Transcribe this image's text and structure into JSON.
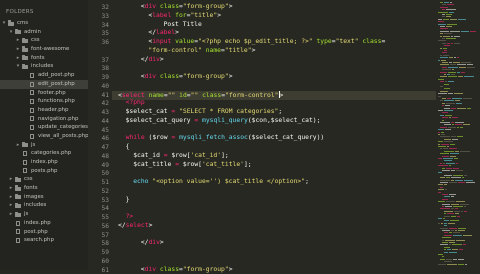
{
  "sidebar": {
    "header": "FOLDERS",
    "items": [
      {
        "type": "folder",
        "depth": 0,
        "label": "cms",
        "open": true,
        "selected": false
      },
      {
        "type": "folder",
        "depth": 1,
        "label": "admin",
        "open": true,
        "selected": false
      },
      {
        "type": "folder",
        "depth": 2,
        "label": "css",
        "open": false,
        "selected": false
      },
      {
        "type": "folder",
        "depth": 2,
        "label": "font-awesome",
        "open": false,
        "selected": false
      },
      {
        "type": "folder",
        "depth": 2,
        "label": "fonts",
        "open": false,
        "selected": false
      },
      {
        "type": "folder",
        "depth": 2,
        "label": "includes",
        "open": true,
        "selected": false
      },
      {
        "type": "file",
        "depth": 3,
        "label": "add_post.php",
        "selected": false
      },
      {
        "type": "file",
        "depth": 3,
        "label": "edit_post.php",
        "selected": true
      },
      {
        "type": "file",
        "depth": 3,
        "label": "footer.php",
        "selected": false
      },
      {
        "type": "file",
        "depth": 3,
        "label": "functions.php",
        "selected": false
      },
      {
        "type": "file",
        "depth": 3,
        "label": "header.php",
        "selected": false
      },
      {
        "type": "file",
        "depth": 3,
        "label": "navigation.php",
        "selected": false
      },
      {
        "type": "file",
        "depth": 3,
        "label": "update_categories.p",
        "selected": false
      },
      {
        "type": "file",
        "depth": 3,
        "label": "view_all_posts.php",
        "selected": false
      },
      {
        "type": "folder",
        "depth": 2,
        "label": "js",
        "open": false,
        "selected": false
      },
      {
        "type": "file",
        "depth": 2,
        "label": "categories.php",
        "selected": false
      },
      {
        "type": "file",
        "depth": 2,
        "label": "index.php",
        "selected": false
      },
      {
        "type": "file",
        "depth": 2,
        "label": "posts.php",
        "selected": false
      },
      {
        "type": "folder",
        "depth": 1,
        "label": "css",
        "open": false,
        "selected": false
      },
      {
        "type": "folder",
        "depth": 1,
        "label": "fonts",
        "open": false,
        "selected": false
      },
      {
        "type": "folder",
        "depth": 1,
        "label": "images",
        "open": false,
        "selected": false
      },
      {
        "type": "folder",
        "depth": 1,
        "label": "includes",
        "open": false,
        "selected": false
      },
      {
        "type": "folder",
        "depth": 1,
        "label": "js",
        "open": false,
        "selected": false
      },
      {
        "type": "file",
        "depth": 1,
        "label": "index.php",
        "selected": false
      },
      {
        "type": "file",
        "depth": 1,
        "label": "post.php",
        "selected": false
      },
      {
        "type": "file",
        "depth": 1,
        "label": "search.php",
        "selected": false
      }
    ]
  },
  "editor": {
    "active_line": 41,
    "lines": [
      {
        "n": "32",
        "indent": 3,
        "tokens": [
          [
            "p",
            "<"
          ],
          [
            "t",
            "div"
          ],
          [
            "a",
            " class"
          ],
          [
            "p",
            "="
          ],
          [
            "s",
            "\"form-group\""
          ],
          [
            "p",
            ">"
          ]
        ]
      },
      {
        "n": "33",
        "indent": 4,
        "tokens": [
          [
            "p",
            "<"
          ],
          [
            "t",
            "label"
          ],
          [
            "a",
            " for"
          ],
          [
            "p",
            "="
          ],
          [
            "s",
            "\"title\""
          ],
          [
            "p",
            ">"
          ]
        ]
      },
      {
        "n": "34",
        "indent": 6,
        "tokens": [
          [
            "v",
            "Post Title"
          ]
        ]
      },
      {
        "n": "35",
        "indent": 4,
        "tokens": [
          [
            "p",
            "</"
          ],
          [
            "t",
            "label"
          ],
          [
            "p",
            ">"
          ]
        ]
      },
      {
        "n": "36",
        "indent": 4,
        "tokens": [
          [
            "p",
            "<"
          ],
          [
            "t",
            "input"
          ],
          [
            "a",
            " value"
          ],
          [
            "p",
            "="
          ],
          [
            "s",
            "\"<?php echo $p_edit_title; ?>\""
          ],
          [
            "a",
            " type"
          ],
          [
            "p",
            "="
          ],
          [
            "s",
            "\"text\""
          ],
          [
            "a",
            " class"
          ],
          [
            "p",
            "="
          ]
        ]
      },
      {
        "n": "",
        "indent": 4,
        "tokens": [
          [
            "s",
            "\"form-control\""
          ],
          [
            "a",
            " name"
          ],
          [
            "p",
            "="
          ],
          [
            "s",
            "\"title\""
          ],
          [
            "p",
            ">"
          ]
        ]
      },
      {
        "n": "37",
        "indent": 3,
        "tokens": [
          [
            "p",
            "</"
          ],
          [
            "t",
            "div"
          ],
          [
            "p",
            ">"
          ]
        ]
      },
      {
        "n": "38",
        "indent": 0,
        "tokens": []
      },
      {
        "n": "39",
        "indent": 3,
        "tokens": [
          [
            "p",
            "<"
          ],
          [
            "t",
            "div"
          ],
          [
            "a",
            " class"
          ],
          [
            "p",
            "="
          ],
          [
            "s",
            "\"form-group\""
          ],
          [
            "p",
            ">"
          ]
        ]
      },
      {
        "n": "40",
        "indent": 0,
        "tokens": []
      },
      {
        "n": "41",
        "indent": 0,
        "cursor": true,
        "tokens": [
          [
            "p",
            "<"
          ],
          [
            "t",
            "select"
          ],
          [
            "a",
            " name"
          ],
          [
            "p",
            "="
          ],
          [
            "s",
            "\"\""
          ],
          [
            "a",
            " id"
          ],
          [
            "p",
            "="
          ],
          [
            "s",
            "\"\""
          ],
          [
            "a",
            " class"
          ],
          [
            "p",
            "="
          ],
          [
            "s",
            "\"form-control\""
          ],
          [
            "p",
            ">"
          ]
        ]
      },
      {
        "n": "42",
        "indent": 1,
        "tokens": [
          [
            "t",
            "<?php"
          ]
        ]
      },
      {
        "n": "43",
        "indent": 1,
        "tokens": [
          [
            "v",
            "$select_cat"
          ],
          [
            "t",
            " = "
          ],
          [
            "s",
            "\"SELECT * FROM categories\""
          ],
          [
            "p",
            ";"
          ]
        ]
      },
      {
        "n": "44",
        "indent": 1,
        "tokens": [
          [
            "v",
            "$select_cat_query"
          ],
          [
            "t",
            " = "
          ],
          [
            "k",
            "mysqli_query"
          ],
          [
            "p",
            "($con,$select_cat);"
          ]
        ]
      },
      {
        "n": "45",
        "indent": 0,
        "tokens": []
      },
      {
        "n": "46",
        "indent": 1,
        "tokens": [
          [
            "t",
            "while"
          ],
          [
            "p",
            " ("
          ],
          [
            "v",
            "$row"
          ],
          [
            "t",
            " = "
          ],
          [
            "k",
            "mysqli_fetch_assoc"
          ],
          [
            "p",
            "($select_cat_query))"
          ]
        ]
      },
      {
        "n": "47",
        "indent": 1,
        "tokens": [
          [
            "p",
            "{"
          ]
        ]
      },
      {
        "n": "48",
        "indent": 2,
        "tokens": [
          [
            "v",
            "$cat_id"
          ],
          [
            "t",
            " = "
          ],
          [
            "v",
            "$row["
          ],
          [
            "s",
            "'cat_id'"
          ],
          [
            "v",
            "];"
          ]
        ]
      },
      {
        "n": "49",
        "indent": 2,
        "tokens": [
          [
            "v",
            "$cat_title"
          ],
          [
            "t",
            " = "
          ],
          [
            "v",
            "$row["
          ],
          [
            "s",
            "'cat_title'"
          ],
          [
            "v",
            "];"
          ]
        ]
      },
      {
        "n": "50",
        "indent": 0,
        "tokens": []
      },
      {
        "n": "51",
        "indent": 2,
        "tokens": [
          [
            "k",
            "echo"
          ],
          [
            "s",
            " \"<option value='') $cat_title </option>\""
          ],
          [
            "p",
            ";"
          ]
        ]
      },
      {
        "n": "52",
        "indent": 0,
        "tokens": []
      },
      {
        "n": "53",
        "indent": 1,
        "tokens": [
          [
            "p",
            "}"
          ]
        ]
      },
      {
        "n": "54",
        "indent": 0,
        "tokens": []
      },
      {
        "n": "55",
        "indent": 1,
        "tokens": [
          [
            "t",
            "?>"
          ]
        ]
      },
      {
        "n": "56",
        "indent": 0,
        "tokens": [
          [
            "p",
            "</"
          ],
          [
            "t",
            "select"
          ],
          [
            "p",
            ">"
          ]
        ]
      },
      {
        "n": "57",
        "indent": 0,
        "tokens": []
      },
      {
        "n": "58",
        "indent": 3,
        "tokens": [
          [
            "p",
            "</"
          ],
          [
            "t",
            "div"
          ],
          [
            "p",
            ">"
          ]
        ]
      },
      {
        "n": "59",
        "indent": 0,
        "tokens": []
      },
      {
        "n": "60",
        "indent": 0,
        "tokens": []
      },
      {
        "n": "61",
        "indent": 3,
        "tokens": [
          [
            "p",
            "<"
          ],
          [
            "t",
            "div"
          ],
          [
            "a",
            " class"
          ],
          [
            "p",
            "="
          ],
          [
            "s",
            "\"form-group\""
          ],
          [
            "p",
            ">"
          ]
        ]
      }
    ]
  },
  "colors": {
    "background": "#272822",
    "tag": "#f92672",
    "attr": "#a6e22e",
    "string": "#e6db74",
    "function": "#66d9ef",
    "text": "#f8f8f2",
    "line_number": "#8f908a"
  }
}
